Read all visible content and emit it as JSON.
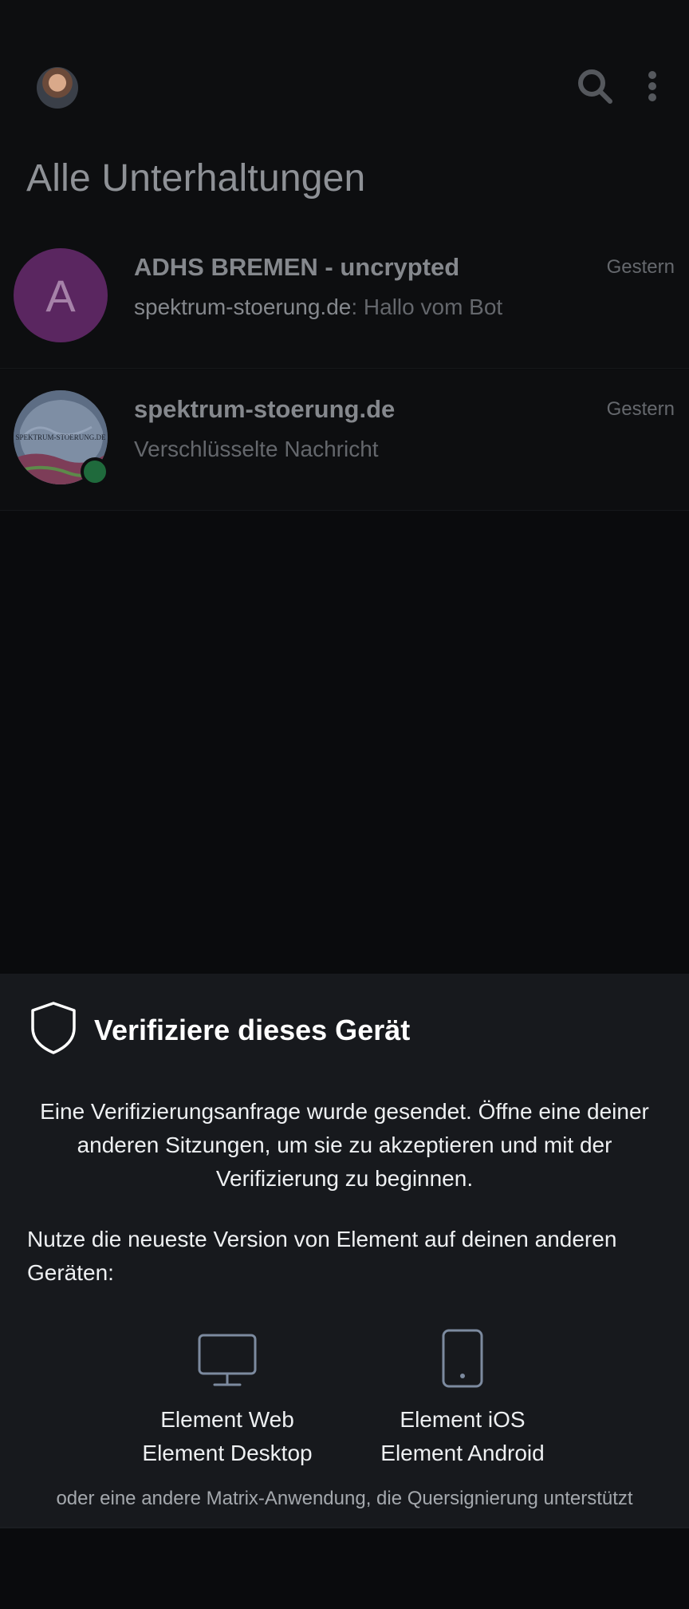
{
  "header": {
    "title": "Alle Unterhaltungen"
  },
  "rooms": [
    {
      "avatar_letter": "A",
      "name": "ADHS BREMEN - uncrypted",
      "time": "Gestern",
      "preview_sender": "spektrum-stoerung.de",
      "preview_text": ": Hallo vom Bot"
    },
    {
      "avatar_caption": "SPEKTRUM-STOERUNG.DE",
      "name": "spektrum-stoerung.de",
      "time": "Gestern",
      "preview_text": "Verschlüsselte Nachricht"
    }
  ],
  "verify_sheet": {
    "title": "Verifiziere dieses Gerät",
    "body": "Eine Verifizierungsanfrage wurde gesendet. Öffne eine deiner anderen Sitzungen, um sie zu akzeptieren und mit der Verifizierung zu beginnen.",
    "hint": "Nutze die neueste Version von Element auf deinen anderen Geräten:",
    "devices": [
      {
        "line1": "Element Web",
        "line2": "Element Desktop",
        "icon": "monitor-icon"
      },
      {
        "line1": "Element iOS",
        "line2": "Element Android",
        "icon": "phone-icon"
      }
    ],
    "footnote": "oder eine andere Matrix-Anwendung, die Quersignierung unterstützt"
  },
  "colors": {
    "background": "#0a0b0d",
    "sheet": "#17191d",
    "letter_avatar": "#5a2660",
    "presence": "#1f6a3c"
  }
}
